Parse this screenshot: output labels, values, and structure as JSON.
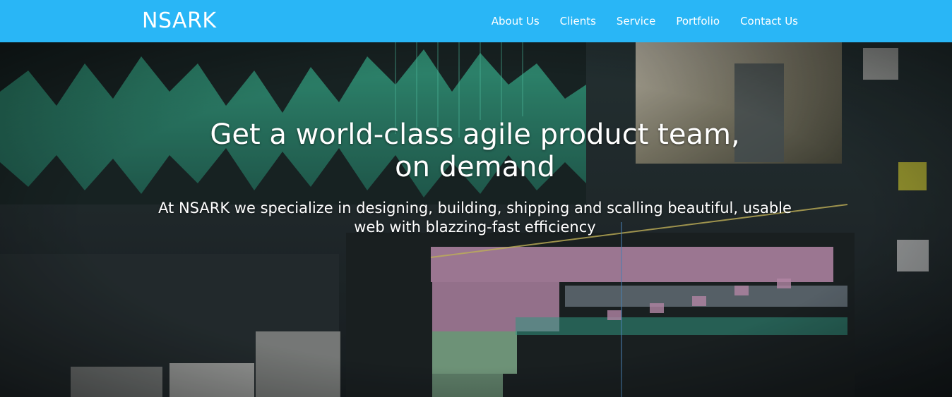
{
  "brand": {
    "name": "NSARK"
  },
  "nav": {
    "items": [
      {
        "label": "About Us"
      },
      {
        "label": "Clients"
      },
      {
        "label": "Service"
      },
      {
        "label": "Portfolio"
      },
      {
        "label": "Contact Us"
      }
    ]
  },
  "hero": {
    "title": "Get a world-class agile product team, on demand",
    "subtitle": "At NSARK we specialize in designing, building, shipping and scalling beautiful, usable web with blazzing-fast efficiency",
    "background_description_icon": "video-editing-timeline-image"
  },
  "colors": {
    "navbar": "#29b6f6",
    "text": "#ffffff"
  }
}
